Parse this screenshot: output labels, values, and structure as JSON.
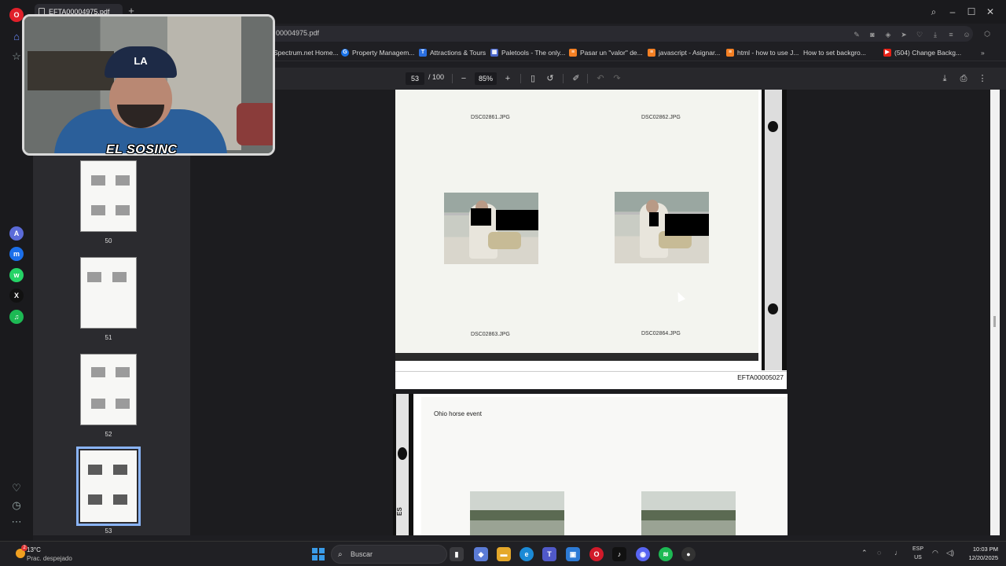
{
  "browser": {
    "tab_title": "EFTA00004975.pdf",
    "url": "00004975.pdf",
    "bookmarks": [
      {
        "label": "Spectrum.net Home...",
        "color": "#1b5fa8"
      },
      {
        "label": "Property Managem...",
        "color": "#1a73e8",
        "glyph": "G"
      },
      {
        "label": "Attractions & Tours",
        "color": "#2b6fe0",
        "glyph": "T"
      },
      {
        "label": "Paletools - The only...",
        "color": "#4a66c8"
      },
      {
        "label": "Pasar un \"valor\" de...",
        "color": "#f48024"
      },
      {
        "label": "javascript - Asignar...",
        "color": "#f48024"
      },
      {
        "label": "html - how to use J...",
        "color": "#f48024"
      },
      {
        "label": "How to set backgro...",
        "color": "#333333",
        "glyph": "(A)"
      },
      {
        "label": "(504) Change Backg...",
        "color": "#e62117"
      }
    ]
  },
  "pdf": {
    "current_page": "53",
    "total_pages": "/ 100",
    "zoom": "85%",
    "thumbnails": [
      {
        "number": "50"
      },
      {
        "number": "51"
      },
      {
        "number": "52"
      },
      {
        "number": "53",
        "selected": true
      }
    ],
    "page1": {
      "captions": [
        "DSC02861.JPG",
        "DSC02862.JPG",
        "DSC02863.JPG",
        "DSC02864.JPG"
      ],
      "page_id": "EFTA00005027"
    },
    "page2": {
      "caption": "Ohio horse event",
      "side_text": "ES"
    }
  },
  "overlay": {
    "streamer_name": "EL SOSINC",
    "cap_logo": "LA"
  },
  "taskbar": {
    "weather_temp": "13°C",
    "weather_desc": "Prac. despejado",
    "weather_badge": "2",
    "search_placeholder": "Buscar",
    "lang_line1": "ESP",
    "lang_line2": "US",
    "time": "10:03 PM",
    "date": "12/20/2025"
  },
  "colors": {
    "accent": "#8ab4f8",
    "redaction": "#000000"
  }
}
